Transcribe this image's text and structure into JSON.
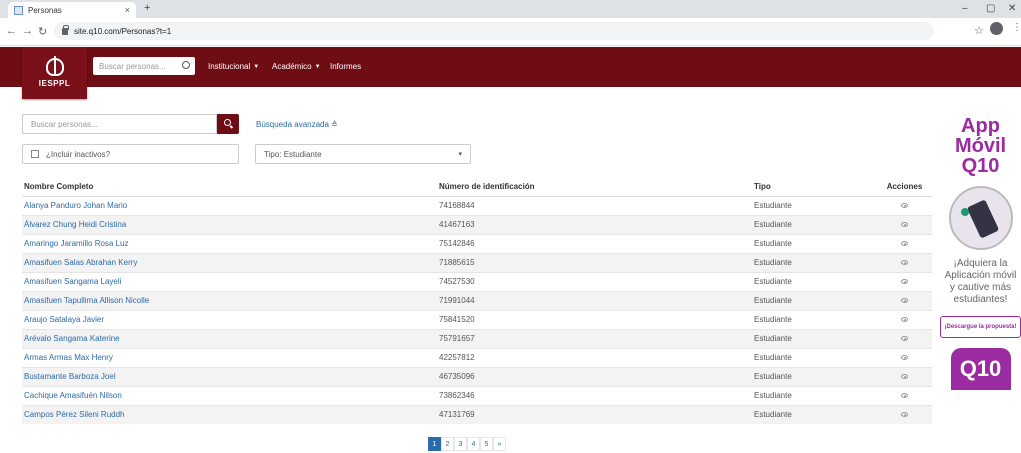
{
  "browser": {
    "tab_title": "Personas",
    "tab_close": "×",
    "new_tab": "+",
    "win_min": "–",
    "win_max": "▢",
    "win_close": "✕",
    "url": "site.q10.com/Personas?t=1"
  },
  "header": {
    "logo_text": "IESPPL",
    "search_placeholder": "Buscar personas...",
    "menu": [
      {
        "label": "Institucional"
      },
      {
        "label": "Académico"
      },
      {
        "label": "Informes"
      }
    ]
  },
  "filters": {
    "search_placeholder": "Buscar personas...",
    "advanced_link": "Búsqueda avanzada ≙",
    "include_inactive": "¿Incluir inactivos?",
    "type_select": "Tipo: Estudiante"
  },
  "table": {
    "headers": [
      "Nombre Completo",
      "Número de identificación",
      "Tipo",
      "Acciones"
    ],
    "rows": [
      {
        "name": "Alanya Panduro Johan Mario",
        "id": "74168844",
        "type": "Estudiante"
      },
      {
        "name": "Álvarez Chung Heidi Cristina",
        "id": "41467163",
        "type": "Estudiante"
      },
      {
        "name": "Amaringo Jaramillo Rosa Luz",
        "id": "75142846",
        "type": "Estudiante"
      },
      {
        "name": "Amasifuen Salas Abrahan Kerry",
        "id": "71885615",
        "type": "Estudiante"
      },
      {
        "name": "Amasifuen Sangama Layeli",
        "id": "74527530",
        "type": "Estudiante"
      },
      {
        "name": "Amasifuen Tapullima Allison Nicolle",
        "id": "71991044",
        "type": "Estudiante"
      },
      {
        "name": "Araujo Satalaya Javier",
        "id": "75841520",
        "type": "Estudiante"
      },
      {
        "name": "Arévalo Sangama Katerine",
        "id": "75791657",
        "type": "Estudiante"
      },
      {
        "name": "Armas Armas Max Henry",
        "id": "42257812",
        "type": "Estudiante"
      },
      {
        "name": "Bustamante Barboza Joel",
        "id": "46735096",
        "type": "Estudiante"
      },
      {
        "name": "Cachique Amasifuén Nilson",
        "id": "73862346",
        "type": "Estudiante"
      },
      {
        "name": "Campos Pérez Sileni Ruddh",
        "id": "47131769",
        "type": "Estudiante"
      }
    ]
  },
  "pagination": [
    "1",
    "2",
    "3",
    "4",
    "5",
    "»"
  ],
  "ad": {
    "title_1": "App",
    "title_2": "Móvil",
    "title_3": "Q10",
    "text": "¡Adquiera la Aplicación móvil y cautive más estudiantes!",
    "button": "¡Descargue la propuesta!",
    "logo": "Q10"
  }
}
